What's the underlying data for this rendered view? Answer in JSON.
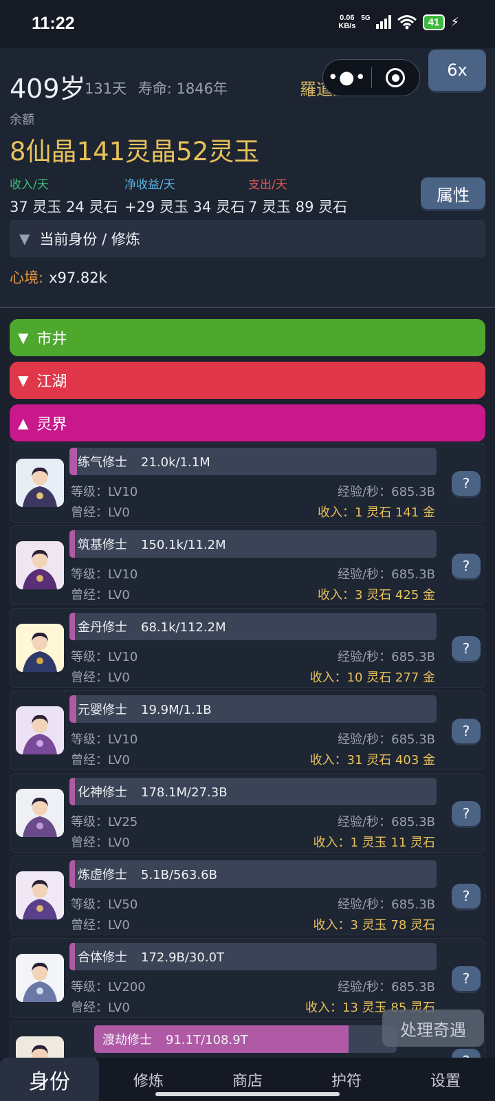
{
  "status_bar": {
    "time": "11:22",
    "net_speed": "0.06",
    "net_unit": "KB/s",
    "signal_type": "5G",
    "wifi_sub": "6",
    "battery": "41"
  },
  "header": {
    "age": "409岁",
    "days": "131天",
    "lifespan": "寿命: 1846年",
    "character_name": "羅道人",
    "speed_label": "6x",
    "balance_label": "余额",
    "balance": "8仙晶141灵晶52灵玉",
    "income": {
      "label": "收入/天",
      "value": "37 灵玉 24 灵石",
      "color": "#3fbf7a"
    },
    "net": {
      "label": "净收益/天",
      "value": "+29 灵玉 34 灵石",
      "color": "#5ab7e6"
    },
    "expense": {
      "label": "支出/天",
      "value": "7 灵玉 89 灵石",
      "color": "#e05a5a"
    },
    "attributes_button": "属性",
    "identity_section": "当前身份 / 修炼",
    "mind_label": "心境:",
    "mind_value": "x97.82k"
  },
  "categories": [
    {
      "label": "市井",
      "arrow": "▼",
      "color": "#4ea82e"
    },
    {
      "label": "江湖",
      "arrow": "▼",
      "color": "#e0384a"
    },
    {
      "label": "灵界",
      "arrow": "▲",
      "color": "#c8188c"
    }
  ],
  "jobs": [
    {
      "name": "练气修士",
      "progress": "21.0k/1.1M",
      "progress_fraction": 0.02,
      "level": "等级：LV10",
      "prev": "曾经：LV0",
      "exp": "经验/秒：685.3B",
      "income": "收入：1 灵石 141 金"
    },
    {
      "name": "筑基修士",
      "progress": "150.1k/11.2M",
      "progress_fraction": 0.013,
      "level": "等级：LV10",
      "prev": "曾经：LV0",
      "exp": "经验/秒：685.3B",
      "income": "收入：3 灵石 425 金"
    },
    {
      "name": "金丹修士",
      "progress": "68.1k/112.2M",
      "progress_fraction": 0.001,
      "level": "等级：LV10",
      "prev": "曾经：LV0",
      "exp": "经验/秒：685.3B",
      "income": "收入：10 灵石 277 金"
    },
    {
      "name": "元婴修士",
      "progress": "19.9M/1.1B",
      "progress_fraction": 0.018,
      "level": "等级：LV10",
      "prev": "曾经：LV0",
      "exp": "经验/秒：685.3B",
      "income": "收入：31 灵石 403 金"
    },
    {
      "name": "化神修士",
      "progress": "178.1M/27.3B",
      "progress_fraction": 0.007,
      "level": "等级：LV25",
      "prev": "曾经：LV0",
      "exp": "经验/秒：685.3B",
      "income": "收入：1 灵玉 11 灵石"
    },
    {
      "name": "炼虚修士",
      "progress": "5.1B/563.6B",
      "progress_fraction": 0.009,
      "level": "等级：LV50",
      "prev": "曾经：LV0",
      "exp": "经验/秒：685.3B",
      "income": "收入：3 灵玉 78 灵石"
    },
    {
      "name": "合体修士",
      "progress": "172.9B/30.0T",
      "progress_fraction": 0.006,
      "level": "等级：LV200",
      "prev": "曾经：LV0",
      "exp": "经验/秒：685.3B",
      "income": "收入：13 灵玉 85 灵石"
    },
    {
      "name": "渡劫修士",
      "progress": "91.1T/108.9T",
      "progress_fraction": 0.84,
      "level": "",
      "prev": "",
      "exp": "",
      "income": ""
    }
  ],
  "help_label": "?",
  "event_button": "处理奇遇",
  "nav": [
    {
      "label": "身份",
      "active": true
    },
    {
      "label": "修炼",
      "active": false
    },
    {
      "label": "商店",
      "active": false
    },
    {
      "label": "护符",
      "active": false
    },
    {
      "label": "设置",
      "active": false
    }
  ]
}
